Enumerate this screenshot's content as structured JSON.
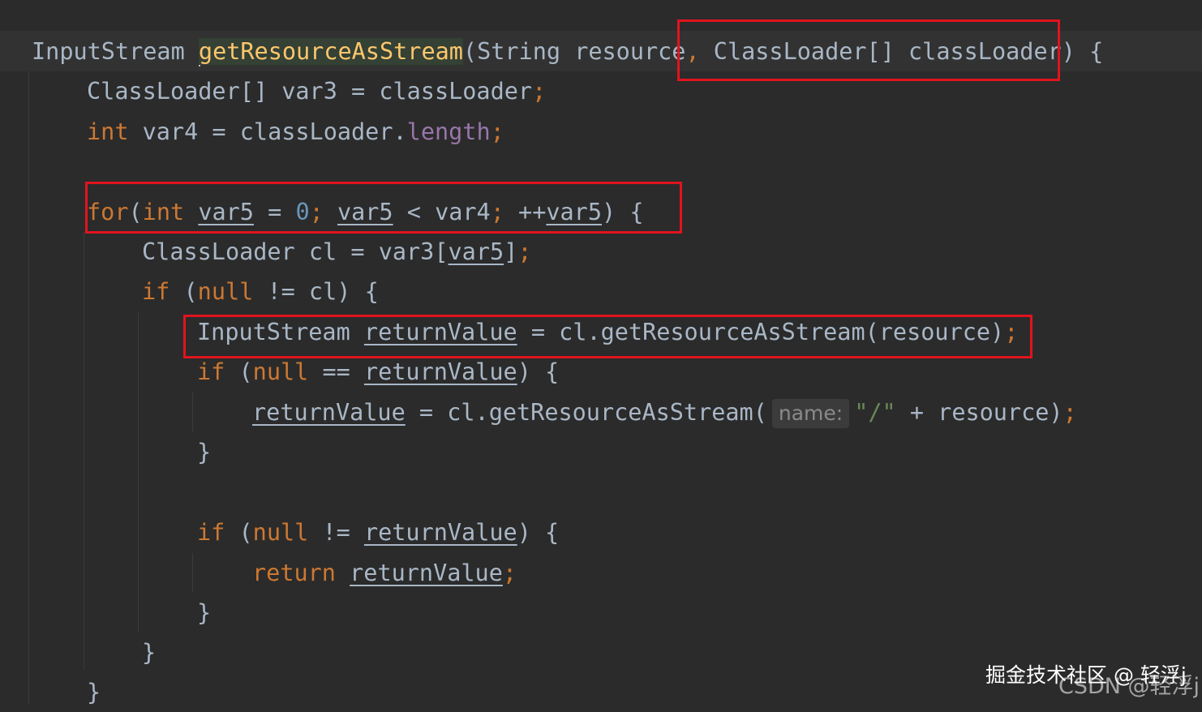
{
  "code": {
    "l1": {
      "t1": "InputStream ",
      "fn": "getResourceAsStream",
      "p1": "(String resource",
      ",": ",",
      "p2": " ClassLoader[] classLoader) {"
    },
    "l2": {
      "t1": "ClassLoader[] var3 = classLoader",
      ";": ";"
    },
    "l3": {
      "kw": "int",
      "t1": " var4 = classLoader.",
      "field": "length",
      ";": ";"
    },
    "l5": {
      "kw1": "for",
      "t1": "(",
      "kw2": "int",
      "t2": " ",
      "v1": "var5",
      "t3": " = ",
      "num": "0",
      ";1": ";",
      "t4": " ",
      "v2": "var5",
      "t5": " < var4",
      ";2": ";",
      "t6": " ++",
      "v3": "var5",
      "t7": ") {"
    },
    "l6": {
      "t1": "ClassLoader cl = var3[",
      "v1": "var5",
      "t2": "]",
      ";": ";"
    },
    "l7": {
      "kw1": "if",
      "t1": " (",
      "kw2": "null",
      "t2": " != cl) {"
    },
    "l8": {
      "t1": "InputStream ",
      "v1": "returnValue",
      "t2": " = cl.getResourceAsStream(resource)",
      ";": ";"
    },
    "l9": {
      "kw1": "if",
      "t1": " (",
      "kw2": "null",
      "t2": " == ",
      "v1": "returnValue",
      "t3": ") {"
    },
    "l10": {
      "v1": "returnValue",
      "t1": " = cl.getResourceAsStream(",
      "hint": "name:",
      "str": "\"/\"",
      "t2": " + resource)",
      ";": ";"
    },
    "l11": {
      "t1": "}"
    },
    "l13": {
      "kw1": "if",
      "t1": " (",
      "kw2": "null",
      "t2": " != ",
      "v1": "returnValue",
      "t3": ") {"
    },
    "l14": {
      "kw1": "return",
      "t1": " ",
      "v1": "returnValue",
      ";": ";"
    },
    "l15": {
      "t1": "}"
    },
    "l16": {
      "t1": "}"
    },
    "l17": {
      "t1": "}"
    }
  },
  "watermark": {
    "front": "掘金技术社区 @ 轻浮j",
    "back": "CSDN @轻浮j"
  },
  "colors": {
    "background": "#2b2b2b",
    "text": "#a9b7c6",
    "keyword": "#cc7832",
    "method": "#ffc66d",
    "field": "#9876aa",
    "number": "#6897bb",
    "string": "#6a8759",
    "annotation_box": "#e0141e"
  }
}
